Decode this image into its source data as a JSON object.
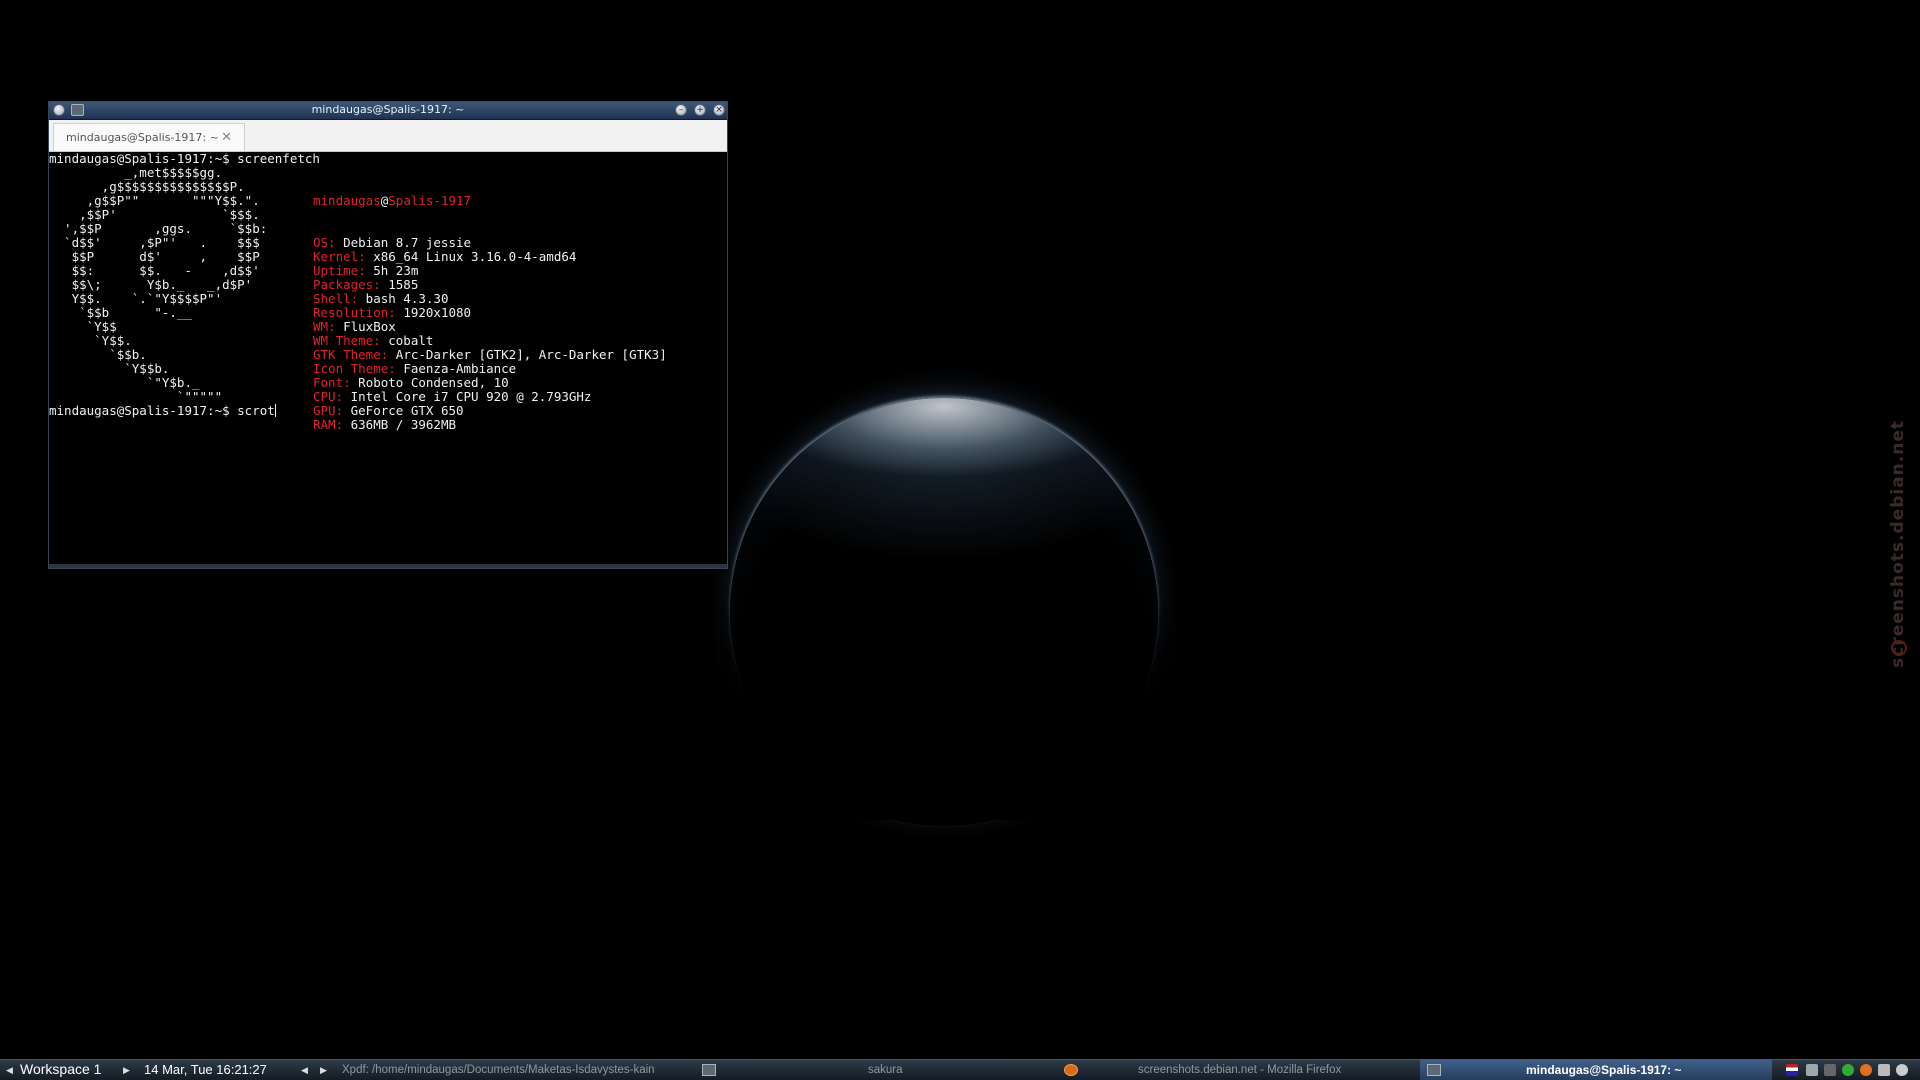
{
  "desktop": {
    "watermark": "screenshots.debian.net"
  },
  "terminal": {
    "title": "mindaugas@Spalis-1917: ~",
    "tab_label": "mindaugas@Spalis-1917: ~",
    "prompt1": "mindaugas@Spalis-1917:~$ screenfetch",
    "prompt2": "mindaugas@Spalis-1917:~$ scrot",
    "logo_lines": [
      "          _,met$$$$$gg.",
      "       ,g$$$$$$$$$$$$$$$P.",
      "     ,g$$P\"\"       \"\"\"Y$$.\".",
      "    ,$$P'              `$$$.",
      "  ',$$P       ,ggs.     `$$b:",
      "  `d$$'     ,$P\"'   .    $$$",
      "   $$P      d$'     ,    $$P",
      "   $$:      $$.   -    ,d$$'",
      "   $$\\;      Y$b._   _,d$P'",
      "   Y$$.    `.`\"Y$$$$P\"'",
      "    `$$b      \"-.__",
      "     `Y$$",
      "      `Y$$.",
      "        `$$b.",
      "          `Y$$b.",
      "             `\"Y$b._",
      "                 `\"\"\"\"\""
    ],
    "user": "mindaugas",
    "at": "@",
    "host": "Spalis-1917",
    "info": [
      {
        "key": "OS:",
        "value": " Debian 8.7 jessie"
      },
      {
        "key": "Kernel:",
        "value": " x86_64 Linux 3.16.0-4-amd64"
      },
      {
        "key": "Uptime:",
        "value": " 5h 23m"
      },
      {
        "key": "Packages:",
        "value": " 1585"
      },
      {
        "key": "Shell:",
        "value": " bash 4.3.30"
      },
      {
        "key": "Resolution:",
        "value": " 1920x1080"
      },
      {
        "key": "WM:",
        "value": " FluxBox"
      },
      {
        "key": "WM Theme:",
        "value": " cobalt"
      },
      {
        "key": "GTK Theme:",
        "value": " Arc-Darker [GTK2], Arc-Darker [GTK3]"
      },
      {
        "key": "Icon Theme:",
        "value": " Faenza-Ambiance"
      },
      {
        "key": "Font:",
        "value": " Roboto Condensed, 10"
      },
      {
        "key": "CPU:",
        "value": " Intel Core i7 CPU 920 @ 2.793GHz"
      },
      {
        "key": "GPU:",
        "value": " GeForce GTX 650"
      },
      {
        "key": "RAM:",
        "value": " 636MB / 3962MB"
      }
    ]
  },
  "taskbar": {
    "workspace": "Workspace 1",
    "clock": "14 Mar, Tue 16:21:27",
    "tasks": [
      "Xpdf: /home/mindaugas/Documents/Maketas-Isdavystes-kain",
      "sakura",
      "screenshots.debian.net - Mozilla Firefox",
      "mindaugas@Spalis-1917: ~"
    ]
  },
  "colors": {
    "accent_red": "#e0232f",
    "titlebar": "#2f4566",
    "background": "#000000"
  }
}
